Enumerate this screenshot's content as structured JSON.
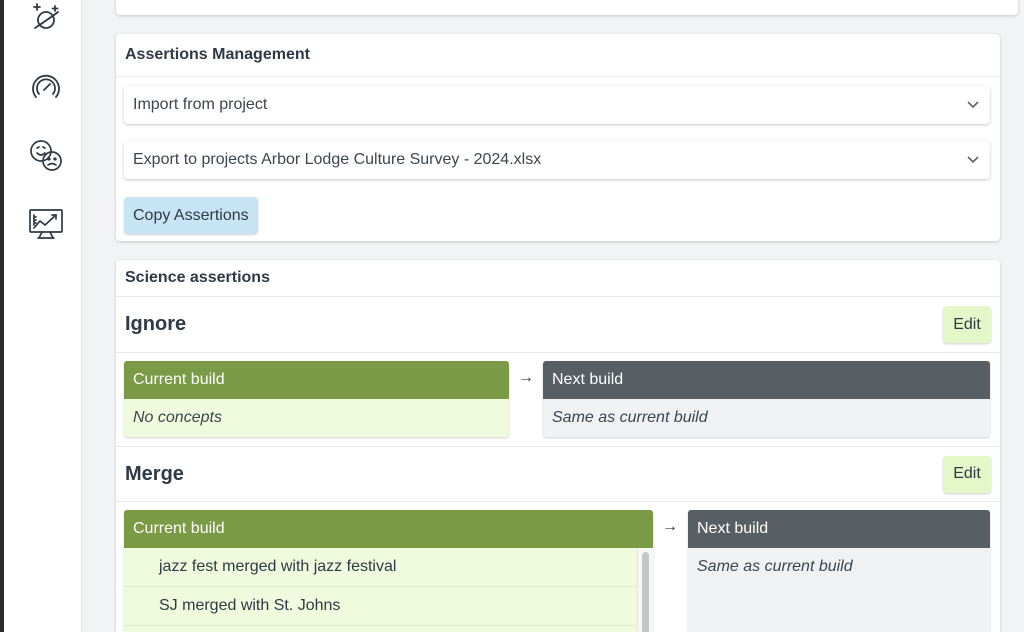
{
  "sidebar": {
    "icons": [
      {
        "name": "planet-sparkle-icon"
      },
      {
        "name": "gauge-icon"
      },
      {
        "name": "sentiment-faces-icon"
      },
      {
        "name": "analytics-monitor-icon"
      }
    ]
  },
  "assertions_management": {
    "title": "Assertions Management",
    "import_select": "Import from project",
    "export_select": "Export to projects Arbor Lodge Culture Survey - 2024.xlsx",
    "copy_button": "Copy Assertions"
  },
  "science_assertions": {
    "title": "Science assertions",
    "ignore": {
      "title": "Ignore",
      "edit_label": "Edit",
      "current_header": "Current build",
      "current_body": "No concepts",
      "arrow": "→",
      "next_header": "Next build",
      "next_body": "Same as current build"
    },
    "merge": {
      "title": "Merge",
      "edit_label": "Edit",
      "current_header": "Current build",
      "items": [
        "jazz fest merged with jazz festival",
        "SJ merged with St. Johns"
      ],
      "arrow": "→",
      "next_header": "Next build",
      "next_body": "Same as current build"
    }
  },
  "colors": {
    "current_header": "#7a9a45",
    "next_header": "#575f64",
    "current_body": "#effbdc",
    "edit_button": "#e4f7c8",
    "copy_button": "#c7e4f5"
  }
}
